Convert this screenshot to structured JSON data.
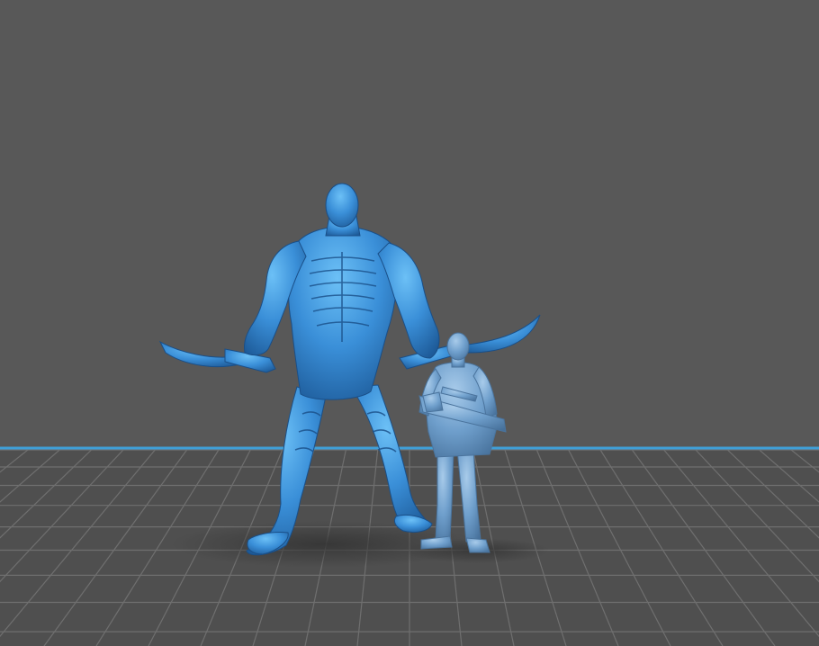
{
  "viewport": {
    "background_color": "#585858",
    "floor_color": "#4d4d4d",
    "grid_line_color": "#6f6f6f",
    "horizon_line_color": "#3f9fd8",
    "shadow_color": "#3c3c3c"
  },
  "models": [
    {
      "name": "creature-warrior",
      "color": "#3a8fd8",
      "highlight": "#5fb3f0",
      "shade": "#1d5a98"
    },
    {
      "name": "soldier-with-rifle",
      "color": "#6f9fcc",
      "highlight": "#9cc3e6",
      "shade": "#4e7aa4"
    }
  ]
}
